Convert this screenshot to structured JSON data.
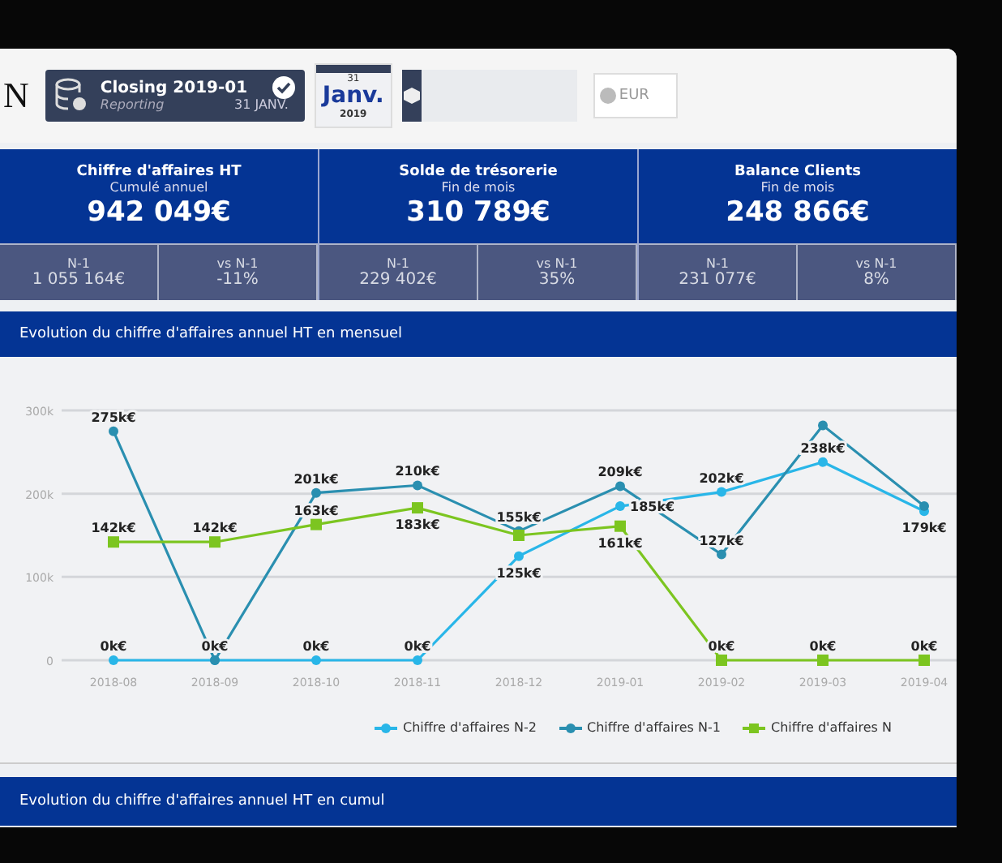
{
  "header": {
    "logo": "N",
    "closing": {
      "title": "Closing 2019-01",
      "subtitle": "Reporting",
      "date": "31 JANV.",
      "checked": true
    },
    "calendar": {
      "day": "31",
      "month": "Janv.",
      "year": "2019"
    },
    "currency": {
      "label": "EUR",
      "on": false
    }
  },
  "kpis": [
    {
      "title": "Chiffre d'affaires HT",
      "subtitle": "Cumulé annuel",
      "value": "942 049€",
      "n1_label": "N-1",
      "n1_value": "1 055 164€",
      "vs_label": "vs N-1",
      "vs_value": "-11%"
    },
    {
      "title": "Solde de trésorerie",
      "subtitle": "Fin de mois",
      "value": "310 789€",
      "n1_label": "N-1",
      "n1_value": "229 402€",
      "vs_label": "vs N-1",
      "vs_value": "35%"
    },
    {
      "title": "Balance Clients",
      "subtitle": "Fin de mois",
      "value": "248 866€",
      "n1_label": "N-1",
      "n1_value": "231 077€",
      "vs_label": "vs N-1",
      "vs_value": "8%"
    }
  ],
  "monthly_panel": {
    "title": "Evolution du chiffre d'affaires annuel HT en mensuel",
    "chart_data": {
      "type": "line",
      "categories": [
        "2018-08",
        "2018-09",
        "2018-10",
        "2018-11",
        "2018-12",
        "2019-01",
        "2019-02",
        "2019-03",
        "2019-04"
      ],
      "yticks": [
        {
          "value": 0,
          "label": "0"
        },
        {
          "value": 100,
          "label": "100k"
        },
        {
          "value": 200,
          "label": "200k"
        },
        {
          "value": 300,
          "label": "300k"
        }
      ],
      "ylim": [
        0,
        300
      ],
      "data_labels": true,
      "legend": true,
      "series": [
        {
          "name": "Chiffre d'affaires N-2",
          "color": "#29b6e8",
          "marker": "circle",
          "values": [
            0,
            0,
            0,
            0,
            125,
            185,
            202,
            238,
            179
          ],
          "value_labels": [
            "0k€",
            null,
            "0k€",
            "0k€",
            "125k€",
            "185k€",
            "202k€",
            "238k€",
            "179k€"
          ]
        },
        {
          "name": "Chiffre d'affaires N-1",
          "color": "#2a8fb0",
          "marker": "circle",
          "values": [
            275,
            0,
            201,
            210,
            155,
            209,
            127,
            282,
            185
          ],
          "value_labels": [
            "275k€",
            "0k€",
            "201k€",
            "210k€",
            "155k€",
            "209k€",
            "127k€",
            null,
            null
          ]
        },
        {
          "name": "Chiffre d'affaires N",
          "color": "#7cc520",
          "marker": "square",
          "values": [
            142,
            142,
            163,
            183,
            150,
            161,
            0,
            0,
            0
          ],
          "value_labels": [
            "142k€",
            "142k€",
            "163k€",
            "183k€",
            null,
            "161k€",
            "0k€",
            "0k€",
            "0k€"
          ]
        }
      ]
    }
  },
  "cumul_panel": {
    "title": "Evolution du chiffre d'affaires annuel HT en cumul"
  }
}
